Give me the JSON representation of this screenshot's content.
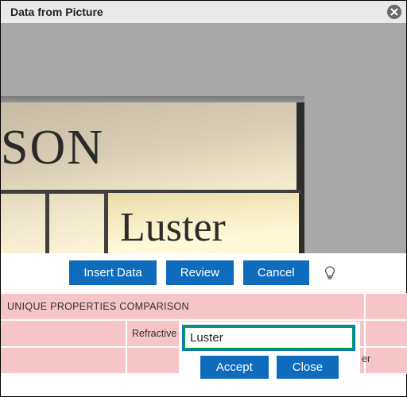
{
  "titlebar": {
    "title": "Data from Picture"
  },
  "preview": {
    "fragment_text": "SON",
    "highlight_cell_text": "Luster"
  },
  "actions": {
    "insert": "Insert Data",
    "review": "Review",
    "cancel": "Cancel"
  },
  "grid": {
    "header": "UNIQUE PROPERTIES COMPARISON",
    "row2_col2": "Refractive I",
    "row3_trailing": "er"
  },
  "review_popup": {
    "value": "Luster",
    "accept": "Accept",
    "close": "Close"
  }
}
